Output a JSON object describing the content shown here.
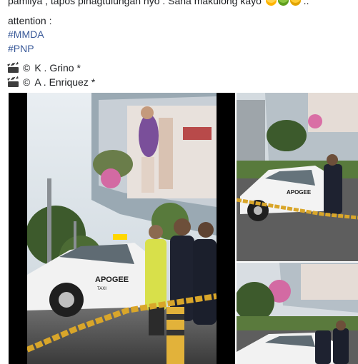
{
  "post": {
    "line1_text": "pamilya , tapos pinagtulungan nyo . Sana makulong kayo",
    "line1_trailing": " ..",
    "emojis": [
      "screaming-face",
      "nauseated-face",
      "angry-face"
    ],
    "attention_text": "attention :",
    "hashtags": [
      "#MMDA",
      "#PNP"
    ],
    "credits": [
      {
        "icon": "clapper-board",
        "copyright": "©",
        "name": "K . Grino *"
      },
      {
        "icon": "clapper-board",
        "copyright": "©",
        "name": "A . Enriquez *"
      }
    ]
  },
  "photos": {
    "main": {
      "building_sign": "APOGEE",
      "sublabel": "TAXI"
    },
    "side_top": {
      "building_sign": "APOGEE"
    },
    "side_bottom": {}
  },
  "colors": {
    "text": "#1c1e21",
    "hashtag": "#385898",
    "background": "#ffffff",
    "chain": "#d9a62a",
    "taxi": "#f2f2f2",
    "uniform": "#1e2230"
  }
}
